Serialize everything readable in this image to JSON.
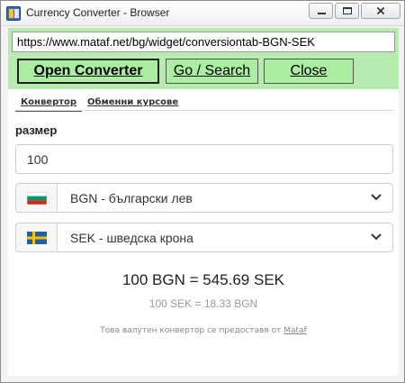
{
  "window": {
    "title": "Currency Converter - Browser",
    "controls": [
      "minimize",
      "maximize",
      "close"
    ]
  },
  "toolbar": {
    "url": "https://www.mataf.net/bg/widget/conversiontab-BGN-SEK",
    "buttons": {
      "open": "Open Converter",
      "search": "Go / Search",
      "close": "Close"
    },
    "background_color": "#b6ecb0"
  },
  "tabs": [
    {
      "label": "Конвертор",
      "active": true
    },
    {
      "label": "Обменни курсове",
      "active": false
    }
  ],
  "converter": {
    "amount_label": "размер",
    "amount_value": "100",
    "from_currency": {
      "label": "BGN - български лев",
      "flag": "bulgaria-flag-icon"
    },
    "to_currency": {
      "label": "SEK - шведска крона",
      "flag": "sweden-flag-icon"
    },
    "result_main": "100 BGN = 545.69 SEK",
    "result_inverse": "100 SEK = 18.33 BGN"
  },
  "footer": {
    "text": "Това валутен конвертор се предоставя от",
    "link": "Mataf"
  }
}
